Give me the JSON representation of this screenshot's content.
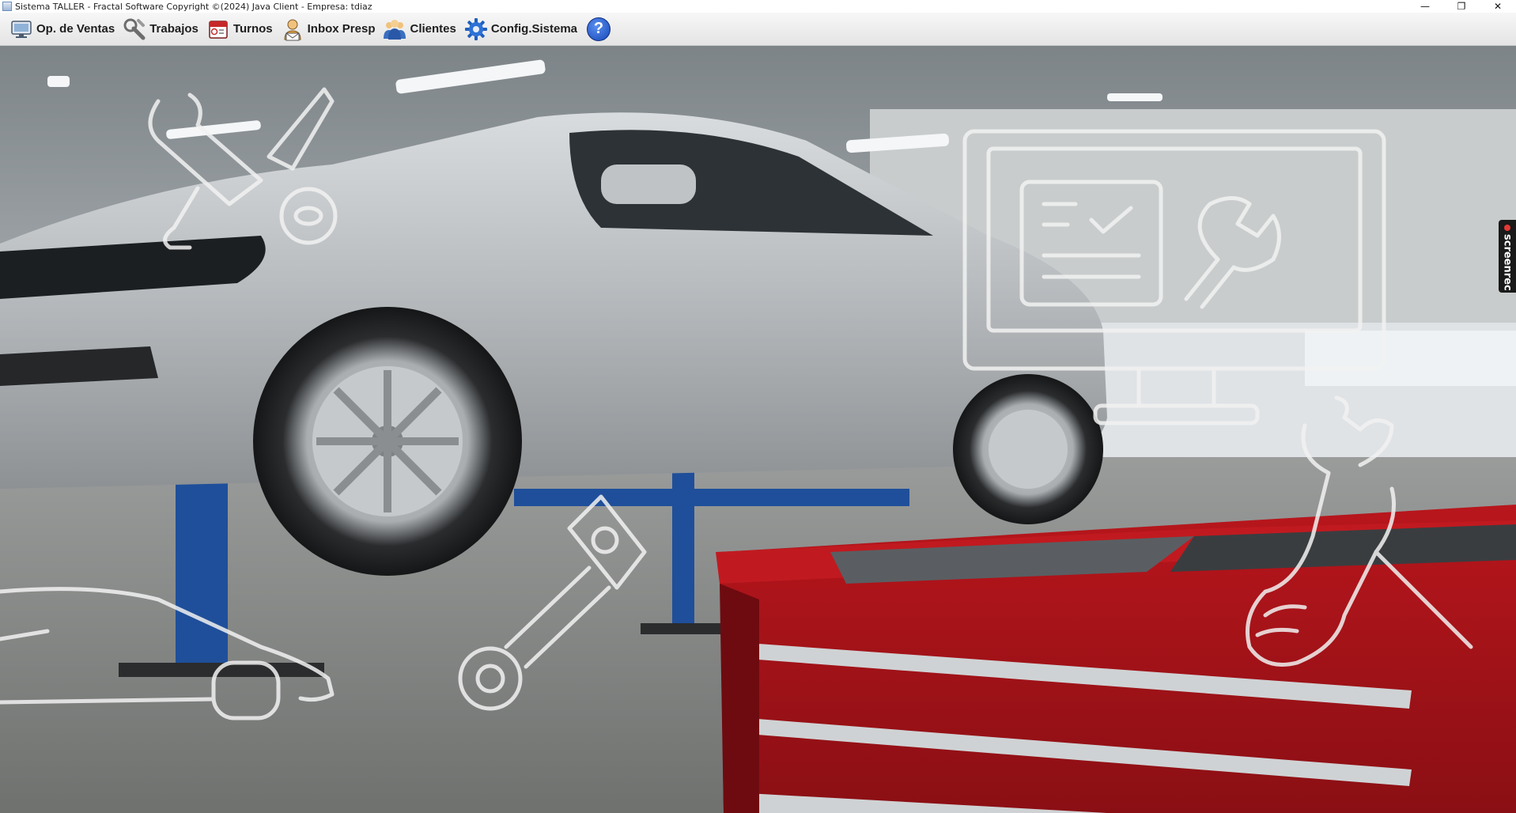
{
  "window": {
    "title": "Sistema TALLER - Fractal Software Copyright ©(2024) Java Client - Empresa: tdiaz",
    "controls": [
      "minimize",
      "restore",
      "close"
    ]
  },
  "menubar": {
    "items": [
      {
        "label": "Op. de Ventas",
        "icon": "sales-monitor-icon"
      },
      {
        "label": "Trabajos",
        "icon": "wrench-icon"
      },
      {
        "label": "Turnos",
        "icon": "calendar-icon"
      },
      {
        "label": "Inbox Presp",
        "icon": "inbox-user-icon"
      },
      {
        "label": "Clientes",
        "icon": "clients-icon"
      },
      {
        "label": "Config.Sistema",
        "icon": "gear-icon"
      }
    ],
    "help": {
      "label": "?",
      "icon": "help-icon"
    }
  },
  "overlay": {
    "screenrec_label": "screenrec"
  },
  "colors": {
    "menu_background": "#ececec",
    "toolbox_red": "#a8141a",
    "lift_blue": "#1f4f9a",
    "help_blue": "#1f55c8"
  }
}
